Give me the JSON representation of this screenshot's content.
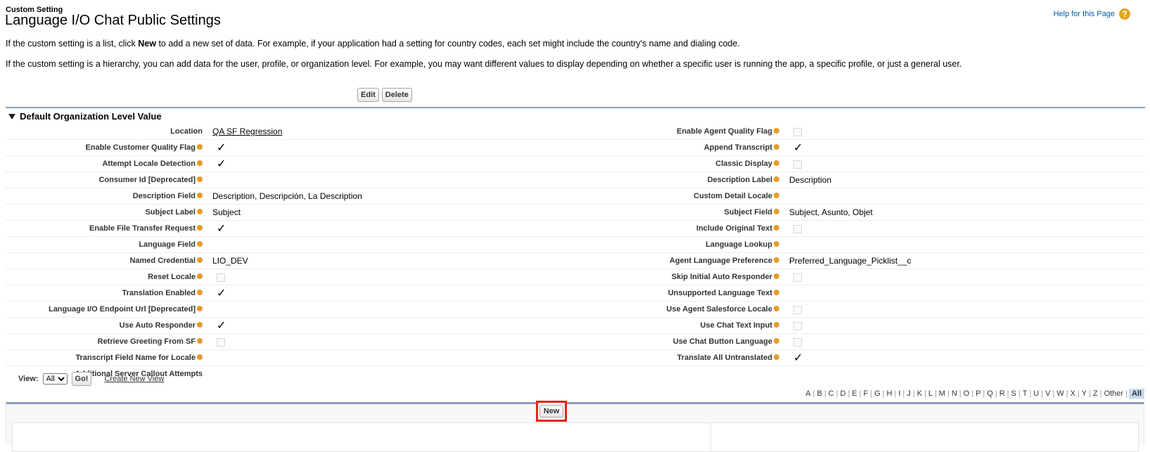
{
  "header": {
    "breadcrumb": "Custom Setting",
    "title": "Language I/O Chat Public Settings",
    "help_label": "Help for this Page",
    "help_icon": "?"
  },
  "description": {
    "line1_pre": "If the custom setting is a list, click ",
    "line1_bold": "New",
    "line1_post": " to add a new set of data. For example, if your application had a setting for country codes, each set might include the country's name and dialing code.",
    "line2": "If the custom setting is a hierarchy, you can add data for the user, profile, or organization level. For example, you may want different values to display depending on whether a specific user is running the app, a specific profile, or just a general user."
  },
  "buttons": {
    "edit": "Edit",
    "delete": "Delete",
    "new": "New",
    "go": "Go!"
  },
  "section": {
    "title": "Default Organization Level Value"
  },
  "rows": [
    {
      "l_label": "Location",
      "l_info": false,
      "l_type": "link",
      "l_value": "QA SF Regression",
      "r_label": "Enable Agent Quality Flag",
      "r_type": "checkbox",
      "r_checked": false
    },
    {
      "l_label": "Enable Customer Quality Flag",
      "l_info": true,
      "l_type": "checkbox",
      "l_checked": true,
      "r_label": "Append Transcript",
      "r_type": "checkbox",
      "r_checked": true
    },
    {
      "l_label": "Attempt Locale Detection",
      "l_info": true,
      "l_type": "checkbox",
      "l_checked": true,
      "r_label": "Classic Display",
      "r_type": "checkbox",
      "r_checked": false
    },
    {
      "l_label": "Consumer Id [Deprecated]",
      "l_info": true,
      "l_type": "text",
      "l_value": "",
      "r_label": "Description Label",
      "r_type": "text",
      "r_value": "Description"
    },
    {
      "l_label": "Description Field",
      "l_info": true,
      "l_type": "text",
      "l_value": "Description, Descripción, La Description",
      "r_label": "Custom Detail Locale",
      "r_type": "text",
      "r_value": ""
    },
    {
      "l_label": "Subject Label",
      "l_info": true,
      "l_type": "text",
      "l_value": "Subject",
      "r_label": "Subject Field",
      "r_type": "text",
      "r_value": "Subject, Asunto, Objet"
    },
    {
      "l_label": "Enable File Transfer Request",
      "l_info": true,
      "l_type": "checkbox",
      "l_checked": true,
      "r_label": "Include Original Text",
      "r_type": "checkbox",
      "r_checked": false
    },
    {
      "l_label": "Language Field",
      "l_info": true,
      "l_type": "text",
      "l_value": "",
      "r_label": "Language Lookup",
      "r_type": "text",
      "r_value": ""
    },
    {
      "l_label": "Named Credential",
      "l_info": true,
      "l_type": "text",
      "l_value": "LIO_DEV",
      "r_label": "Agent Language Preference",
      "r_type": "text",
      "r_value": "Preferred_Language_Picklist__c"
    },
    {
      "l_label": "Reset Locale",
      "l_info": true,
      "l_type": "checkbox",
      "l_checked": false,
      "r_label": "Skip Initial Auto Responder",
      "r_type": "checkbox",
      "r_checked": false
    },
    {
      "l_label": "Translation Enabled",
      "l_info": true,
      "l_type": "checkbox",
      "l_checked": true,
      "r_label": "Unsupported Language Text",
      "r_type": "text",
      "r_value": ""
    },
    {
      "l_label": "Language I/O Endpoint Url [Deprecated]",
      "l_info": true,
      "l_type": "text",
      "l_value": "",
      "r_label": "Use Agent Salesforce Locale",
      "r_type": "checkbox",
      "r_checked": false
    },
    {
      "l_label": "Use Auto Responder",
      "l_info": true,
      "l_type": "checkbox",
      "l_checked": true,
      "r_label": "Use Chat Text Input",
      "r_type": "checkbox",
      "r_checked": false
    },
    {
      "l_label": "Retrieve Greeting From SF",
      "l_info": true,
      "l_type": "checkbox",
      "l_checked": false,
      "r_label": "Use Chat Button Language",
      "r_type": "checkbox",
      "r_checked": false
    },
    {
      "l_label": "Transcript Field Name for Locale",
      "l_info": true,
      "l_type": "text",
      "l_value": "",
      "r_label": "Translate All Untranslated",
      "r_type": "checkbox",
      "r_checked": true
    },
    {
      "l_label": "Additional Server Callout Attempts",
      "l_info": false,
      "l_type": "text",
      "l_value": "",
      "r_label": "",
      "r_type": "none"
    }
  ],
  "view_bar": {
    "label": "View:",
    "selected": "All",
    "create_view": "Create New View"
  },
  "alphabet": [
    "A",
    "B",
    "C",
    "D",
    "E",
    "F",
    "G",
    "H",
    "I",
    "J",
    "K",
    "L",
    "M",
    "N",
    "O",
    "P",
    "Q",
    "R",
    "S",
    "T",
    "U",
    "V",
    "W",
    "X",
    "Y",
    "Z",
    "Other"
  ],
  "alphabet_all": "All",
  "checkmark": "✓"
}
